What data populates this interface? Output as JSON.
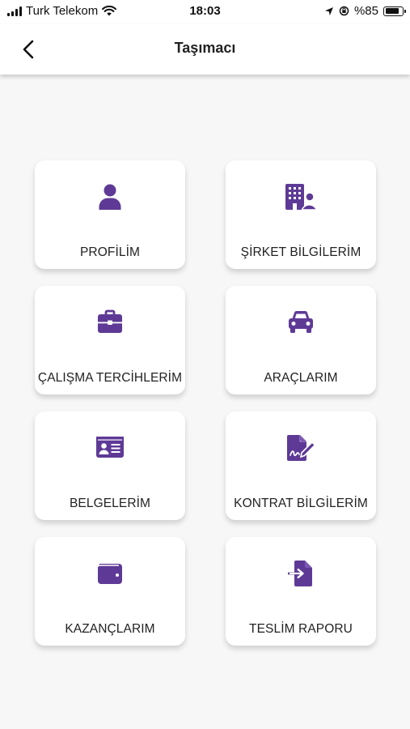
{
  "status_bar": {
    "carrier": "Turk Telekom",
    "time": "18:03",
    "battery_text": "%85",
    "battery_level": 0.85
  },
  "header": {
    "title": "Taşımacı"
  },
  "accent_color": "#5e3a96",
  "menu": [
    {
      "label": "PROFİLİM",
      "icon": "user-icon"
    },
    {
      "label": "ŞİRKET BİLGİLERİM",
      "icon": "company-building-icon"
    },
    {
      "label": "ÇALIŞMA TERCİHLERİM",
      "icon": "briefcase-icon"
    },
    {
      "label": "ARAÇLARIM",
      "icon": "car-icon"
    },
    {
      "label": "BELGELERİM",
      "icon": "id-card-icon"
    },
    {
      "label": "KONTRAT BİLGİLERİM",
      "icon": "contract-sign-icon"
    },
    {
      "label": "KAZANÇLARIM",
      "icon": "wallet-icon"
    },
    {
      "label": "TESLİM RAPORU",
      "icon": "file-import-icon"
    }
  ]
}
